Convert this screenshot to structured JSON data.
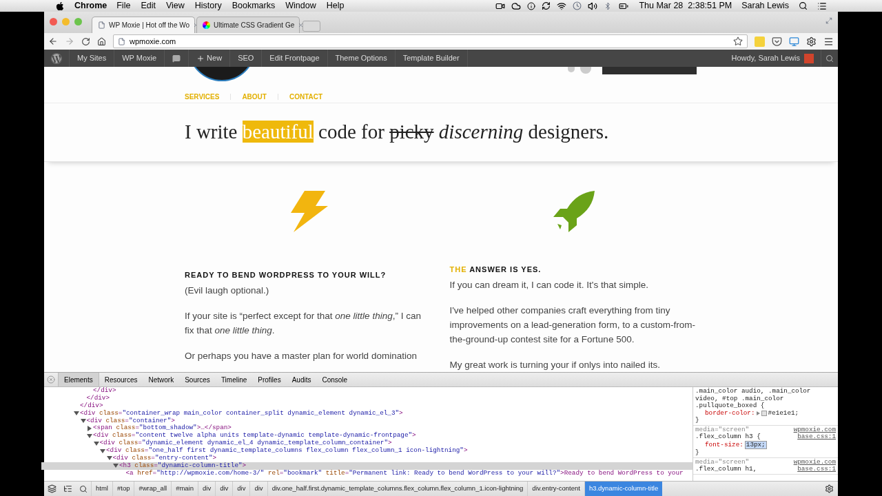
{
  "menubar": {
    "app": "Chrome",
    "menus": [
      "File",
      "Edit",
      "View",
      "History",
      "Bookmarks",
      "Window",
      "Help"
    ],
    "clock": "Thu Mar 28  2:38:51 PM",
    "user": "Sarah Lewis"
  },
  "browser": {
    "tabs": [
      {
        "title": "WP Moxie | Hot off the Wo",
        "selected": true
      },
      {
        "title": "Ultimate CSS Gradient Ge",
        "selected": false
      }
    ],
    "url": "wpmoxie.com"
  },
  "admin_bar": {
    "items": [
      {
        "kind": "logo"
      },
      {
        "kind": "text",
        "label": "My Sites"
      },
      {
        "kind": "text",
        "label": "WP Moxie"
      },
      {
        "kind": "comments"
      },
      {
        "kind": "new",
        "label": "New"
      },
      {
        "kind": "text",
        "label": "SEO"
      },
      {
        "kind": "text",
        "label": "Edit Frontpage"
      },
      {
        "kind": "text",
        "label": "Theme Options"
      },
      {
        "kind": "text",
        "label": "Template Builder"
      }
    ],
    "greeting": "Howdy, Sarah Lewis"
  },
  "site": {
    "nav": [
      "SERVICES",
      "ABOUT",
      "CONTACT"
    ],
    "headline": [
      {
        "text": "I write ",
        "kind": "plain"
      },
      {
        "text": "beautiful",
        "kind": "highlight"
      },
      {
        "text": " code for ",
        "kind": "plain"
      },
      {
        "text": "picky",
        "kind": "strike"
      },
      {
        "text": " discerning",
        "kind": "italic"
      },
      {
        "text": " designers.",
        "kind": "plain"
      }
    ],
    "columns": [
      {
        "kind": "lightning",
        "heading": [
          {
            "text": "READY TO BEND WORDPRESS TO YOUR WILL?",
            "accent": false
          }
        ],
        "paragraphs": [
          "(Evil laugh optional.)",
          "If your site is “perfect except for that *one little thing*,” I can fix that *one little thing*.",
          "Or perhaps you have a master plan for world domination"
        ]
      },
      {
        "kind": "rocket",
        "heading": [
          {
            "text": "THE",
            "accent": true
          },
          {
            "text": "ANSWER IS YES.",
            "accent": false
          }
        ],
        "paragraphs": [
          "If you can dream it, I can code it. It's that simple.",
          "I've helped other companies craft everything from tiny improvements on a lead-generation form, to a custom-from-the-ground-up contest site for a Fortune 500.",
          "My great work is turning your if onlys into nailed its."
        ]
      }
    ]
  },
  "devtools": {
    "tabs": [
      {
        "label": "Elements",
        "selected": true
      },
      {
        "label": "Resources",
        "selected": false
      },
      {
        "label": "Network",
        "selected": false
      },
      {
        "label": "Sources",
        "selected": false
      },
      {
        "label": "Timeline",
        "selected": false
      },
      {
        "label": "Profiles",
        "selected": false
      },
      {
        "label": "Audits",
        "selected": false
      },
      {
        "label": "Console",
        "selected": false
      }
    ],
    "dom_tree": [
      {
        "closing": "</div>",
        "children": [
          {
            "closing": "</div>",
            "children": [
              {
                "closing": "</div>"
              }
            ]
          }
        ]
      },
      {
        "text": "<div class=\"container_wrap main_color container_split dynamic_element dynamic_el_3\">",
        "expanded": true,
        "selected": false,
        "children": [
          {
            "text": "<div class=\"container\">",
            "expanded": true,
            "selected": false,
            "children": [
              {
                "text": "<span class=\"bottom_shadow\">…</span>",
                "expanded": false,
                "selected": false
              },
              {
                "text": "<div class=\"content twelve alpha units template-dynamic template-dynamic-frontpage\">",
                "expanded": true,
                "selected": false,
                "children": [
                  {
                    "text": "<div class=\"dynamic_element dynamic_el_4 dynamic_template_column_container\">",
                    "expanded": true,
                    "selected": false,
                    "children": [
                      {
                        "text": "<div class=\"one_half first dynamic_template_columns flex_column flex_column_1 icon-lightning\">",
                        "expanded": true,
                        "selected": false,
                        "children": [
                          {
                            "text": "<div class=\"entry-content\">",
                            "expanded": true,
                            "selected": false,
                            "children": [
                              {
                                "text": "<h3 class=\"dynamic-column-title\">",
                                "expanded": true,
                                "selected": true,
                                "children": [
                                  {
                                    "text": "<a href=\"http://wpmoxie.com/home-3/\" rel=\"bookmark\" title=\"Permanent link: Ready to bend WordPress to your will?\">Ready to bend WordPress to your",
                                    "selected": false
                                  }
                                ]
                              }
                            ]
                          }
                        ]
                      }
                    ]
                  }
                ]
              }
            ]
          }
        ]
      }
    ],
    "styles": [
      {
        "selector": ".main_color audio, .main_color video, #top .main_color .pullquote_boxed {",
        "declarations": [
          {
            "property": "border-color:",
            "value": "#e1e1e1;",
            "color": "#e1e1e1",
            "editing": false
          }
        ],
        "close": "}"
      },
      {
        "media": "media=\"screen\"",
        "host": "wpmoxie.com",
        "file": "base.css:1",
        "selector": ".flex_column h3 {",
        "declarations": [
          {
            "property": "font-size:",
            "value": "13px;",
            "editing": true
          }
        ],
        "close": "}"
      },
      {
        "media": "media=\"screen\"",
        "host": "wpmoxie.com",
        "file": "base.css:1",
        "selector": ".flex_column h1,"
      }
    ],
    "breadcrumbs": [
      {
        "label": "html",
        "selected": false
      },
      {
        "label": "#top",
        "selected": false
      },
      {
        "label": "#wrap_all",
        "selected": false
      },
      {
        "label": "#main",
        "selected": false
      },
      {
        "label": "div",
        "selected": false
      },
      {
        "label": "div",
        "selected": false
      },
      {
        "label": "div",
        "selected": false
      },
      {
        "label": "div",
        "selected": false
      },
      {
        "label": "div.one_half.first.dynamic_template_columns.flex_column.flex_column_1.icon-lightning",
        "selected": false
      },
      {
        "label": "div.entry-content",
        "selected": false
      },
      {
        "label": "h3.dynamic-column-title",
        "selected": true
      }
    ]
  }
}
